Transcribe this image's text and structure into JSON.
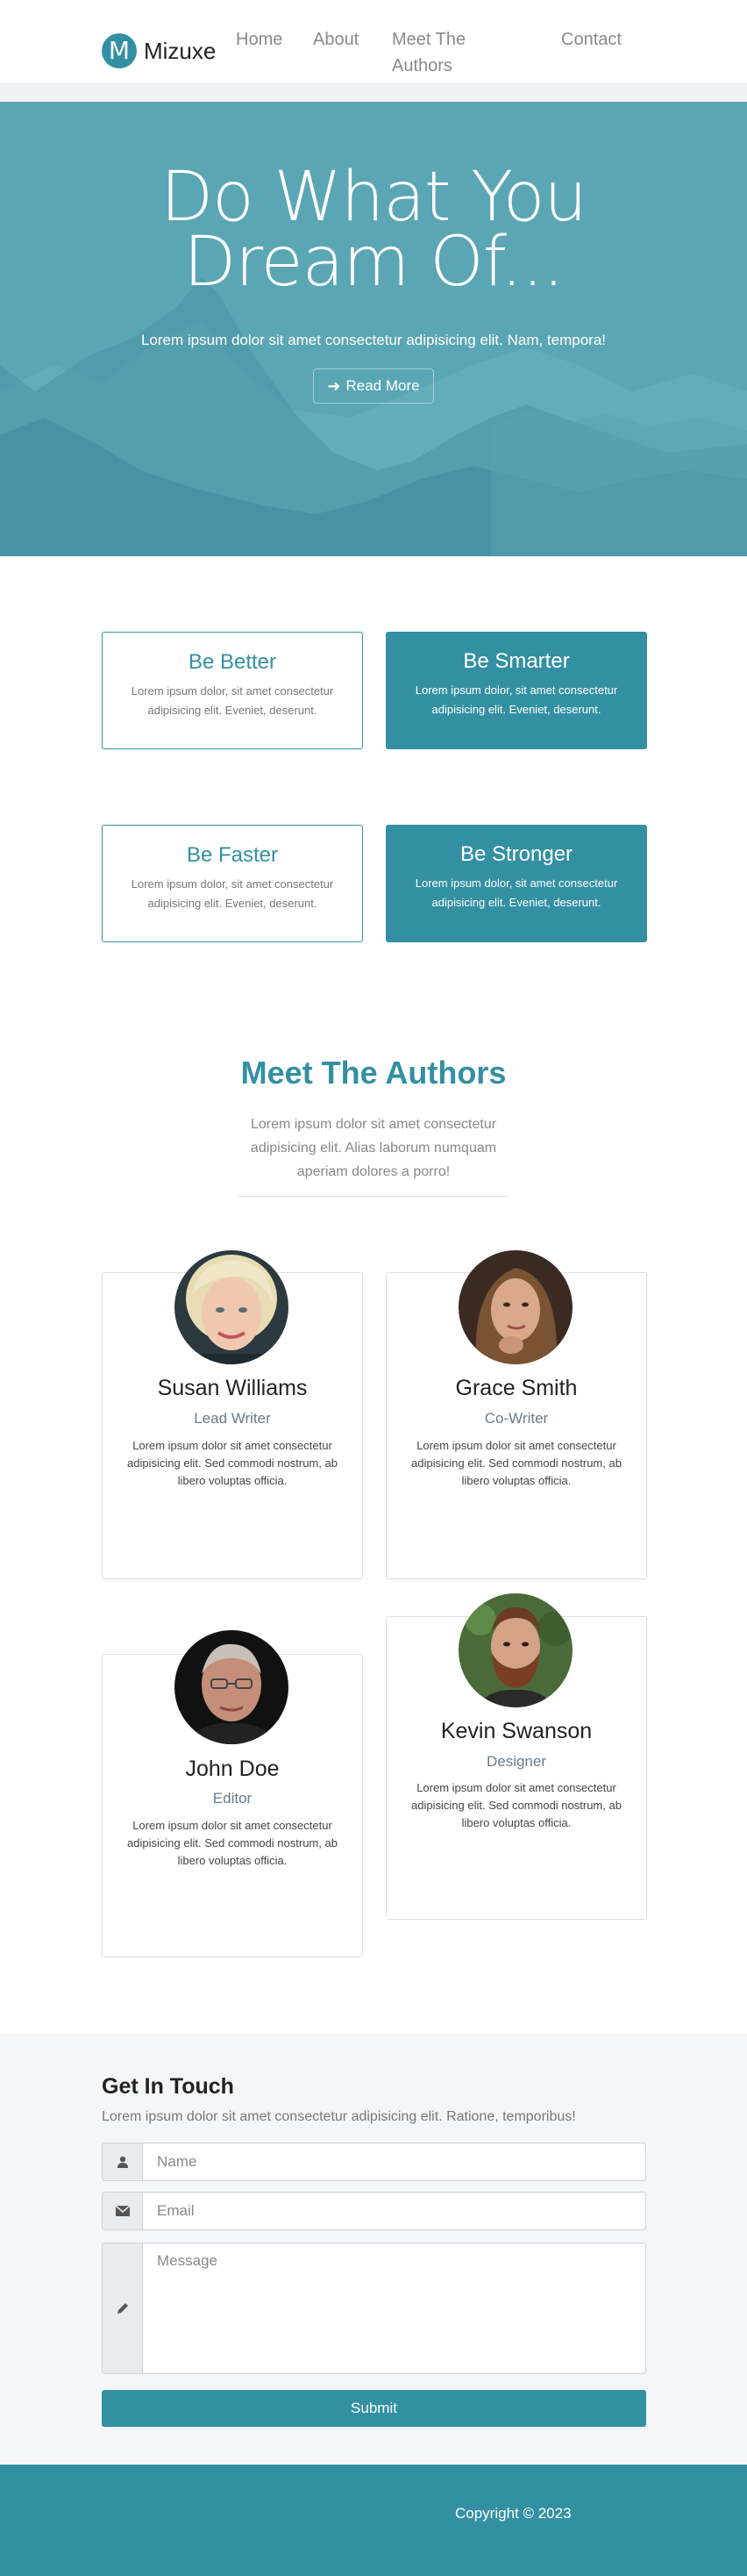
{
  "navbar": {
    "brand_letter": "M",
    "brand_name": "Mizuxe",
    "links": [
      "Home",
      "About",
      "Meet The",
      "Authors",
      "Contact"
    ]
  },
  "hero": {
    "title_line1": "Do What You",
    "title_line2": "Dream Of...",
    "subtitle": "Lorem ipsum dolor sit amet consectetur adipisicing elit. Nam, tempora!",
    "button_label": "Read More",
    "button_icon": "arrow-right-icon"
  },
  "features": [
    {
      "title": "Be Better",
      "text": "Lorem ipsum dolor, sit amet consectetur adipisicing elit. Eveniet, deserunt."
    },
    {
      "title": "Be Smarter",
      "text": "Lorem ipsum dolor, sit amet consectetur adipisicing elit. Eveniet, deserunt."
    },
    {
      "title": "Be Faster",
      "text": "Lorem ipsum dolor, sit amet consectetur adipisicing elit. Eveniet, deserunt."
    },
    {
      "title": "Be Stronger",
      "text": "Lorem ipsum dolor, sit amet consectetur adipisicing elit. Eveniet, deserunt."
    }
  ],
  "authors": {
    "title": "Meet The Authors",
    "subtitle": "Lorem ipsum dolor sit amet consectetur adipisicing elit. Alias laborum numquam aperiam dolores a porro!",
    "cards": [
      {
        "name": "Susan Williams",
        "role": "Lead Writer",
        "bio": "Lorem ipsum dolor sit amet consectetur adipisicing elit. Sed commodi nostrum, ab libero voluptas officia."
      },
      {
        "name": "Grace Smith",
        "role": "Co-Writer",
        "bio": "Lorem ipsum dolor sit amet consectetur adipisicing elit. Sed commodi nostrum, ab libero voluptas officia."
      },
      {
        "name": "John Doe",
        "role": "Editor",
        "bio": "Lorem ipsum dolor sit amet consectetur adipisicing elit. Sed commodi nostrum, ab libero voluptas officia."
      },
      {
        "name": "Kevin Swanson",
        "role": "Designer",
        "bio": "Lorem ipsum dolor sit amet consectetur adipisicing elit. Sed commodi nostrum, ab libero voluptas officia."
      }
    ]
  },
  "contact": {
    "title": "Get In Touch",
    "subtitle": "Lorem ipsum dolor sit amet consectetur adipisicing elit. Ratione, temporibus!",
    "name_placeholder": "Name",
    "email_placeholder": "Email",
    "message_placeholder": "Message",
    "submit_label": "Submit",
    "icons": [
      "user-icon",
      "envelope-icon",
      "pencil-icon"
    ]
  },
  "footer": {
    "copyright": "Copyright © 2023"
  },
  "colors": {
    "primary": "#3390a2",
    "hero_bg": "#5aa6b5",
    "section_bg": "#f5f6f8"
  }
}
